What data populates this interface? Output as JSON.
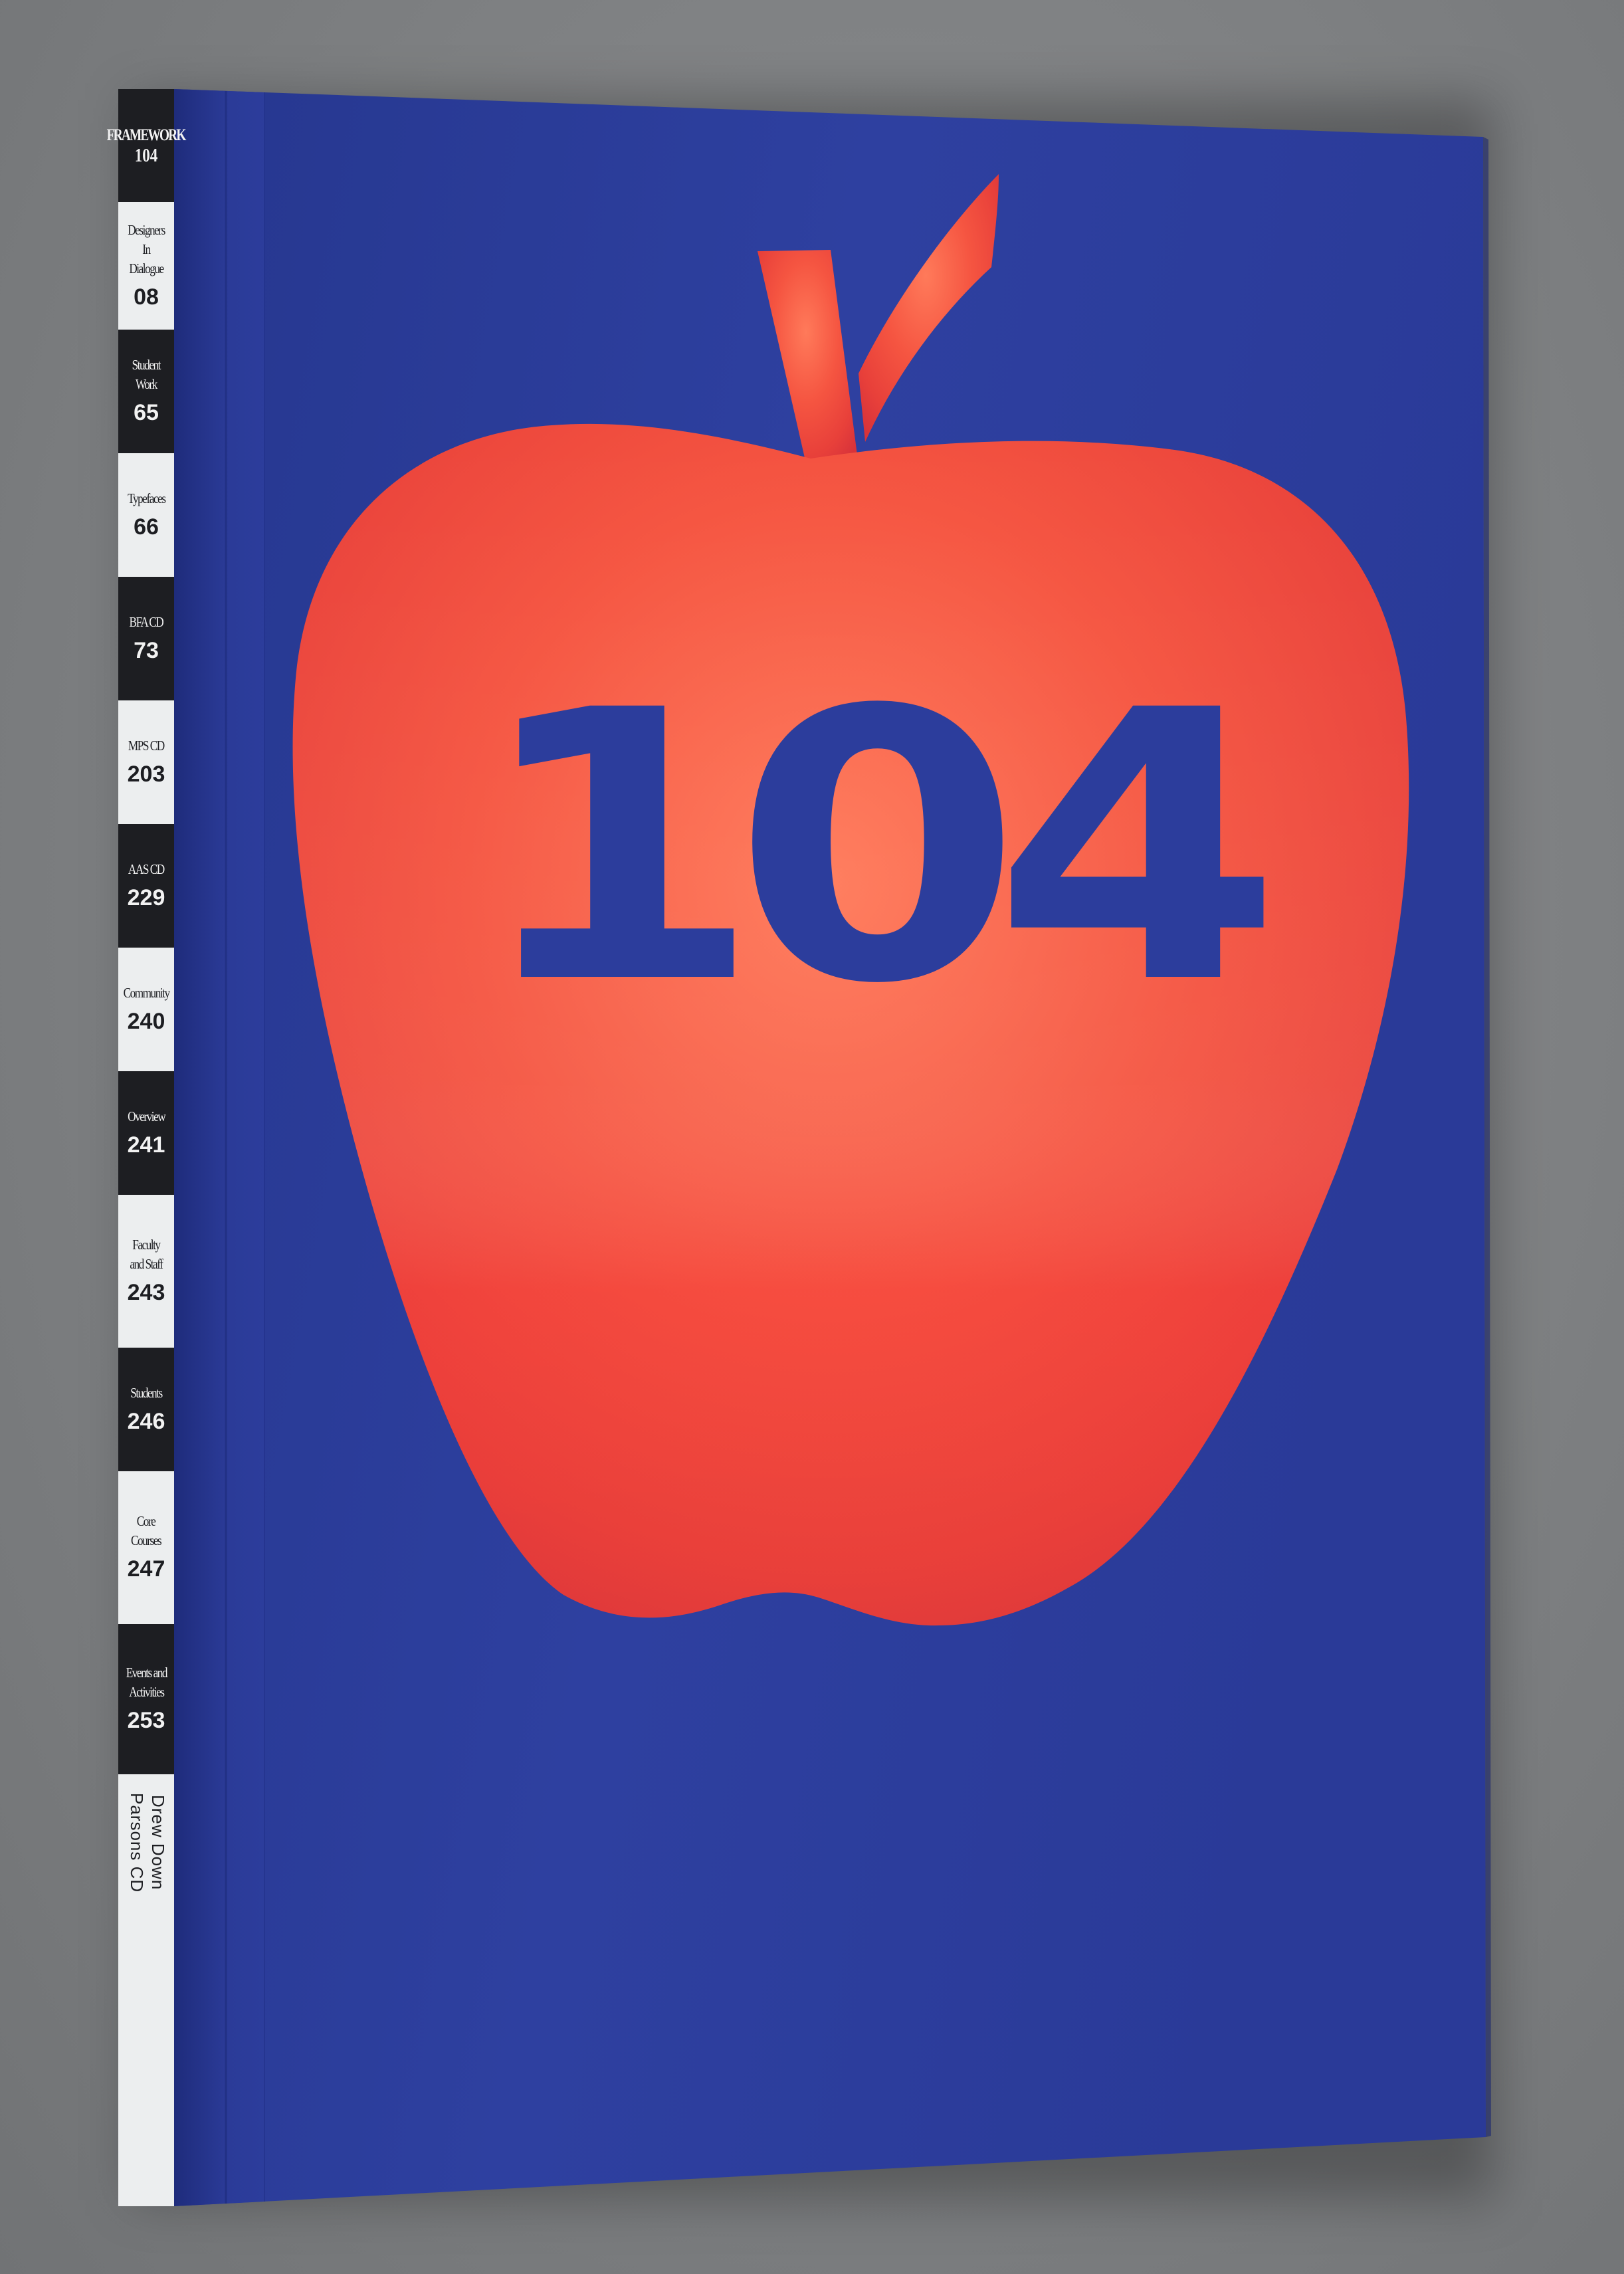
{
  "colors": {
    "cover_blue": "#2c3d9c",
    "apple_red": "#ef4a3c",
    "spine_dark": "#1d1e22",
    "spine_light": "#eceeef",
    "background_gray": "#808284"
  },
  "cover": {
    "number": "104",
    "graphic": "apple-icon"
  },
  "spine": {
    "title": "FRAMEWORK",
    "issue": "104",
    "sections": [
      {
        "label": "Designers\nIn Dialogue",
        "page": "08"
      },
      {
        "label": "Student\nWork",
        "page": "65"
      },
      {
        "label": "Typefaces",
        "page": "66"
      },
      {
        "label": "BFA CD",
        "page": "73"
      },
      {
        "label": "MPS CD",
        "page": "203"
      },
      {
        "label": "AAS CD",
        "page": "229"
      },
      {
        "label": "Community",
        "page": "240"
      },
      {
        "label": "Overview",
        "page": "241"
      },
      {
        "label": "Faculty\nand Staff",
        "page": "243"
      },
      {
        "label": "Students",
        "page": "246"
      },
      {
        "label": "Core\nCourses",
        "page": "247"
      },
      {
        "label": "Events and\nActivities",
        "page": "253"
      }
    ],
    "footer_line1": "Drew Down",
    "footer_line2": "Parsons CD"
  }
}
